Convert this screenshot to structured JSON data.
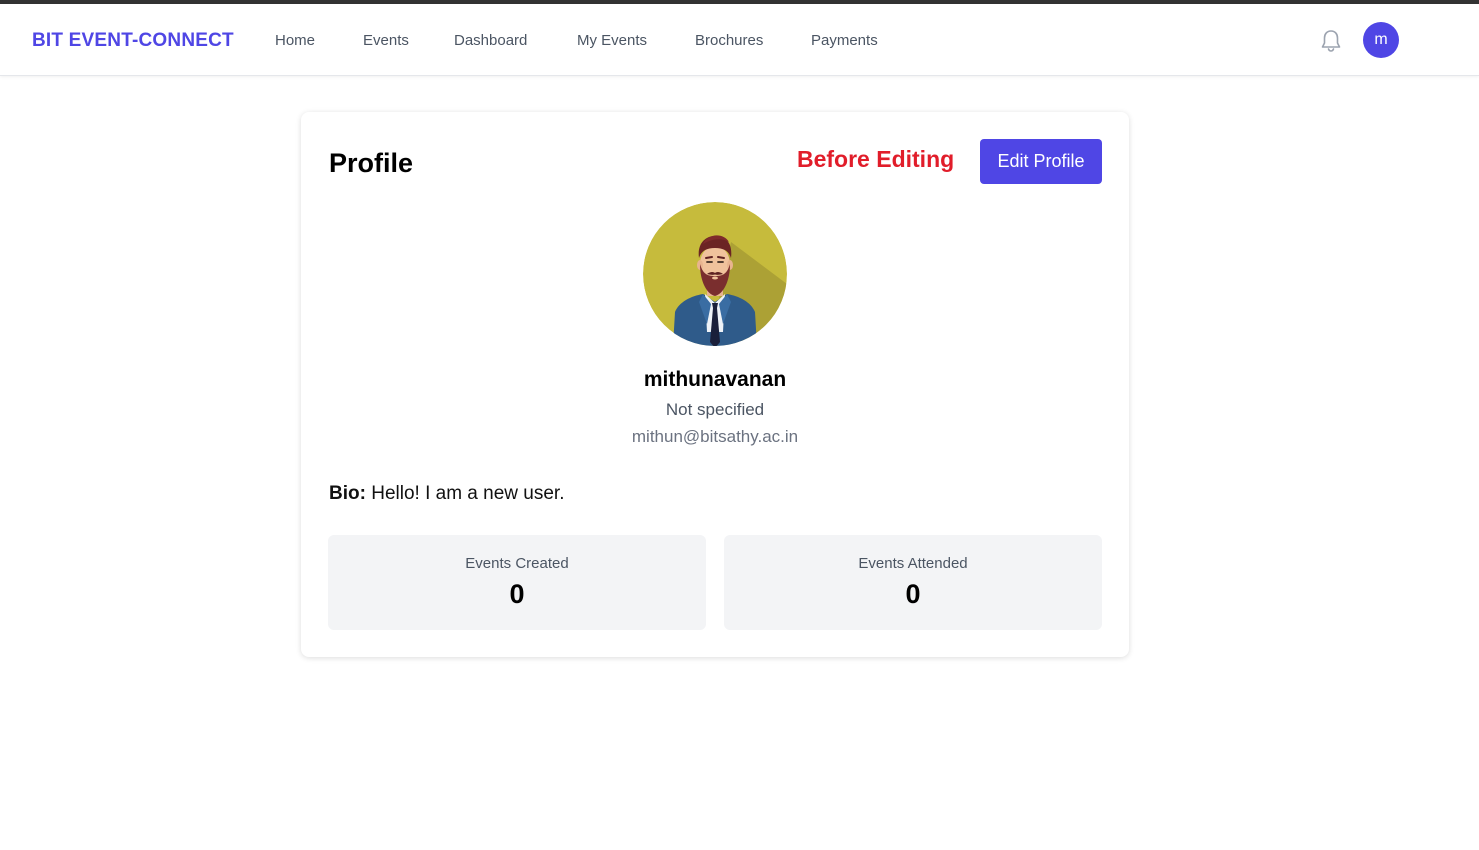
{
  "navbar": {
    "brand": "BIT EVENT-CONNECT",
    "links": [
      "Home",
      "Events",
      "Dashboard",
      "My Events",
      "Brochures",
      "Payments"
    ],
    "bell_icon": "bell-icon",
    "avatar_initial": "m"
  },
  "profile": {
    "title": "Profile",
    "annotation": "Before Editing",
    "edit_label": "Edit Profile",
    "name": "mithunavanan",
    "role": "Not specified",
    "email": "mithun@bitsathy.ac.in",
    "bio_label": "Bio:",
    "bio_text": "Hello! I am a new user.",
    "stats": [
      {
        "label": "Events Created",
        "value": "0"
      },
      {
        "label": "Events Attended",
        "value": "0"
      }
    ]
  },
  "colors": {
    "accent": "#4f46e5",
    "annotation": "#e11d2a",
    "avatar_bg": "#c6bb3c",
    "stat_bg": "#f3f4f6"
  }
}
